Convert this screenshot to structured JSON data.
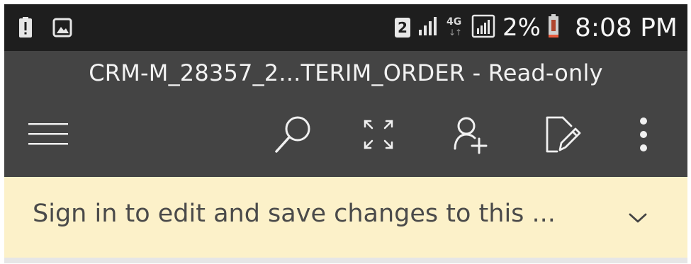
{
  "status_bar": {
    "left_icons": [
      "alert-icon",
      "image-notification-icon"
    ],
    "sim_slot": "2",
    "network_type": "4G",
    "battery_percent": "2%",
    "time": "8:08 PM"
  },
  "app_bar": {
    "document_title": "CRM-M_28357_2...TERIM_ORDER - Read-only",
    "toolbar_icons": [
      "menu-icon",
      "search-icon",
      "fullscreen-icon",
      "share-person-icon",
      "edit-document-icon",
      "more-options-icon"
    ]
  },
  "notice": {
    "message": "Sign in to edit and save changes to this ...",
    "expand_icon": "chevron-down-icon"
  },
  "colors": {
    "status_bar_bg": "#1e1e1e",
    "app_bar_bg": "#444444",
    "notice_bg": "#fcf1c9",
    "battery_low": "#e85a3c"
  }
}
